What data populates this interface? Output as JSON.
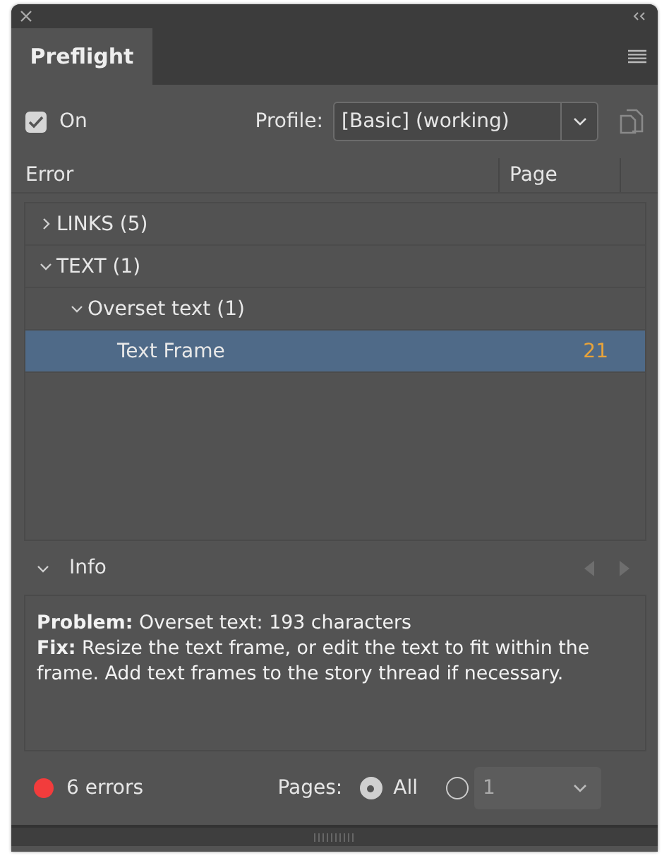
{
  "tab": {
    "label": "Preflight",
    "selected": true
  },
  "on_toggle": {
    "label": "On",
    "checked": true
  },
  "profile": {
    "label": "Profile:",
    "value": "[Basic] (working)"
  },
  "columns": [
    "Error",
    "Page"
  ],
  "tree": [
    {
      "label": "LINKS (5)",
      "expanded": false,
      "selected": false
    },
    {
      "label": "TEXT (1)",
      "expanded": true,
      "selected": false,
      "children": [
        {
          "label": "Overset text (1)",
          "expanded": true,
          "selected": false,
          "children": [
            {
              "label": "Text Frame",
              "page": "21",
              "selected": true
            }
          ]
        }
      ]
    }
  ],
  "info": {
    "title": "Info",
    "expanded": true,
    "lines": [
      "**Problem:** Overset text: 193 characters",
      "**Fix:** Resize the text frame, or edit the text to fit within the frame. Add text frames to the story thread if necessary."
    ]
  },
  "status": {
    "color": "#f23c3c",
    "errors": "6 errors",
    "pages_label": "Pages:",
    "options": [
      {
        "kind": "all",
        "label": "All",
        "selected": true
      },
      {
        "kind": "range",
        "value": "1",
        "selected": false
      }
    ]
  }
}
